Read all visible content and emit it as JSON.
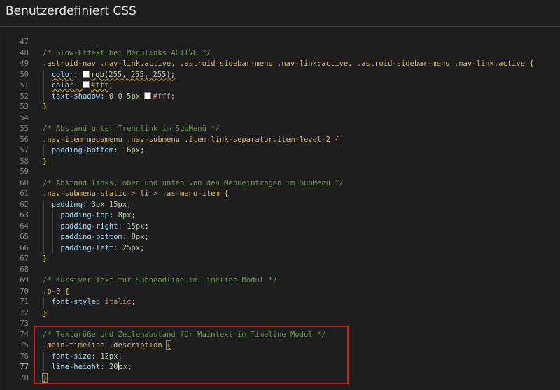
{
  "header": {
    "title": "Benutzerdefiniert CSS"
  },
  "editor": {
    "current_line": "77",
    "lines": [
      {
        "n": "47",
        "tokens": []
      },
      {
        "n": "48",
        "tokens": [
          {
            "t": "/* Glow-Effekt bei Menülinks ACTIVE */",
            "c": "comment"
          }
        ]
      },
      {
        "n": "49",
        "tokens": [
          {
            "t": ".astroid-nav .nav-link.active, .astroid-sidebar-menu .nav-link:active, .astroid-sidebar-menu .nav-link.active ",
            "c": "sel"
          },
          {
            "t": "{",
            "c": "brace"
          }
        ]
      },
      {
        "n": "50",
        "indent": 1,
        "tokens": [
          {
            "t": "color",
            "c": "prop",
            "sq": true
          },
          {
            "t": ": ",
            "c": "punct"
          },
          {
            "t": "",
            "c": "swatch"
          },
          {
            "t": "rgb",
            "c": "fn",
            "sq": true
          },
          {
            "t": "(",
            "c": "punct",
            "sq": true
          },
          {
            "t": "255, 255, 255",
            "c": "num",
            "sq": true
          },
          {
            "t": ");",
            "c": "punct",
            "sq": true
          }
        ]
      },
      {
        "n": "51",
        "indent": 1,
        "tokens": [
          {
            "t": "color",
            "c": "prop",
            "sq": true
          },
          {
            "t": ": ",
            "c": "punct",
            "sq": true
          },
          {
            "t": "",
            "c": "swatch"
          },
          {
            "t": "#fff",
            "c": "val",
            "sq": true
          },
          {
            "t": ";",
            "c": "punct"
          }
        ]
      },
      {
        "n": "52",
        "indent": 1,
        "tokens": [
          {
            "t": "text-shadow",
            "c": "prop"
          },
          {
            "t": ": ",
            "c": "punct"
          },
          {
            "t": "0 0 5px ",
            "c": "num"
          },
          {
            "t": "",
            "c": "swatch"
          },
          {
            "t": "#fff",
            "c": "val"
          },
          {
            "t": ";",
            "c": "punct"
          }
        ]
      },
      {
        "n": "53",
        "tokens": [
          {
            "t": "}",
            "c": "brace"
          }
        ]
      },
      {
        "n": "54",
        "tokens": []
      },
      {
        "n": "55",
        "tokens": [
          {
            "t": "/* Abstand unter Trennlink im SubMenü */",
            "c": "comment"
          }
        ]
      },
      {
        "n": "56",
        "tokens": [
          {
            "t": ".nav-item-megamenu .nav-submenu .item-link-separator.item-level-2 ",
            "c": "sel"
          },
          {
            "t": "{",
            "c": "brace"
          }
        ]
      },
      {
        "n": "57",
        "indent": 1,
        "tokens": [
          {
            "t": "padding-bottom",
            "c": "prop"
          },
          {
            "t": ": ",
            "c": "punct"
          },
          {
            "t": "16px",
            "c": "num"
          },
          {
            "t": ";",
            "c": "punct"
          }
        ]
      },
      {
        "n": "58",
        "tokens": [
          {
            "t": "}",
            "c": "brace"
          }
        ]
      },
      {
        "n": "59",
        "tokens": []
      },
      {
        "n": "60",
        "tokens": [
          {
            "t": "/* Abstand links, oben und unten von den Menüeinträgen im SubMenü */",
            "c": "comment"
          }
        ]
      },
      {
        "n": "61",
        "tokens": [
          {
            "t": ".nav-submenu-static > li > .as-menu-item ",
            "c": "sel"
          },
          {
            "t": "{",
            "c": "brace"
          }
        ]
      },
      {
        "n": "62",
        "indent": 1,
        "tokens": [
          {
            "t": "padding",
            "c": "prop"
          },
          {
            "t": ": ",
            "c": "punct"
          },
          {
            "t": "3px 15px",
            "c": "num"
          },
          {
            "t": ";",
            "c": "punct"
          }
        ]
      },
      {
        "n": "63",
        "indent": 2,
        "tokens": [
          {
            "t": "padding-top",
            "c": "prop"
          },
          {
            "t": ": ",
            "c": "punct"
          },
          {
            "t": "8px",
            "c": "num"
          },
          {
            "t": ";",
            "c": "punct"
          }
        ]
      },
      {
        "n": "64",
        "indent": 2,
        "tokens": [
          {
            "t": "padding-right",
            "c": "prop"
          },
          {
            "t": ": ",
            "c": "punct"
          },
          {
            "t": "15px",
            "c": "num"
          },
          {
            "t": ";",
            "c": "punct"
          }
        ]
      },
      {
        "n": "65",
        "indent": 2,
        "tokens": [
          {
            "t": "padding-bottom",
            "c": "prop"
          },
          {
            "t": ": ",
            "c": "punct"
          },
          {
            "t": "8px",
            "c": "num"
          },
          {
            "t": ";",
            "c": "punct"
          }
        ]
      },
      {
        "n": "66",
        "indent": 2,
        "tokens": [
          {
            "t": "padding-left",
            "c": "prop"
          },
          {
            "t": ": ",
            "c": "punct"
          },
          {
            "t": "25px",
            "c": "num"
          },
          {
            "t": ";",
            "c": "punct"
          }
        ]
      },
      {
        "n": "67",
        "tokens": [
          {
            "t": "}",
            "c": "brace"
          }
        ]
      },
      {
        "n": "68",
        "tokens": []
      },
      {
        "n": "69",
        "tokens": [
          {
            "t": "/* Kursiver Text für Subheadline im Timeline Modul */",
            "c": "comment"
          }
        ]
      },
      {
        "n": "70",
        "tokens": [
          {
            "t": ".p-0 ",
            "c": "sel"
          },
          {
            "t": "{",
            "c": "brace"
          }
        ]
      },
      {
        "n": "71",
        "indent": 1,
        "tokens": [
          {
            "t": "font-style",
            "c": "prop"
          },
          {
            "t": ": ",
            "c": "punct"
          },
          {
            "t": "italic",
            "c": "val"
          },
          {
            "t": ";",
            "c": "punct"
          }
        ]
      },
      {
        "n": "72",
        "tokens": [
          {
            "t": "}",
            "c": "brace"
          }
        ]
      },
      {
        "n": "73",
        "tokens": []
      },
      {
        "n": "74",
        "tokens": [
          {
            "t": "/* Textgröße und Zeilenabstand für Maintext im Timeline Modul */",
            "c": "comment"
          }
        ]
      },
      {
        "n": "75",
        "tokens": [
          {
            "t": ".main-timeline .description ",
            "c": "sel"
          },
          {
            "t": "{",
            "c": "brace",
            "match": true
          }
        ]
      },
      {
        "n": "76",
        "indent": 1,
        "tokens": [
          {
            "t": "font-size",
            "c": "prop"
          },
          {
            "t": ": ",
            "c": "punct"
          },
          {
            "t": "12px",
            "c": "num"
          },
          {
            "t": ";",
            "c": "punct"
          }
        ]
      },
      {
        "n": "77",
        "indent": 1,
        "tokens": [
          {
            "t": "line-height",
            "c": "prop"
          },
          {
            "t": ": ",
            "c": "punct"
          },
          {
            "t": "20",
            "c": "num"
          },
          {
            "t": "",
            "c": "cursor"
          },
          {
            "t": "px",
            "c": "num"
          },
          {
            "t": ";",
            "c": "punct"
          }
        ]
      },
      {
        "n": "78",
        "tokens": [
          {
            "t": "}",
            "c": "brace",
            "match": true
          }
        ]
      }
    ]
  }
}
